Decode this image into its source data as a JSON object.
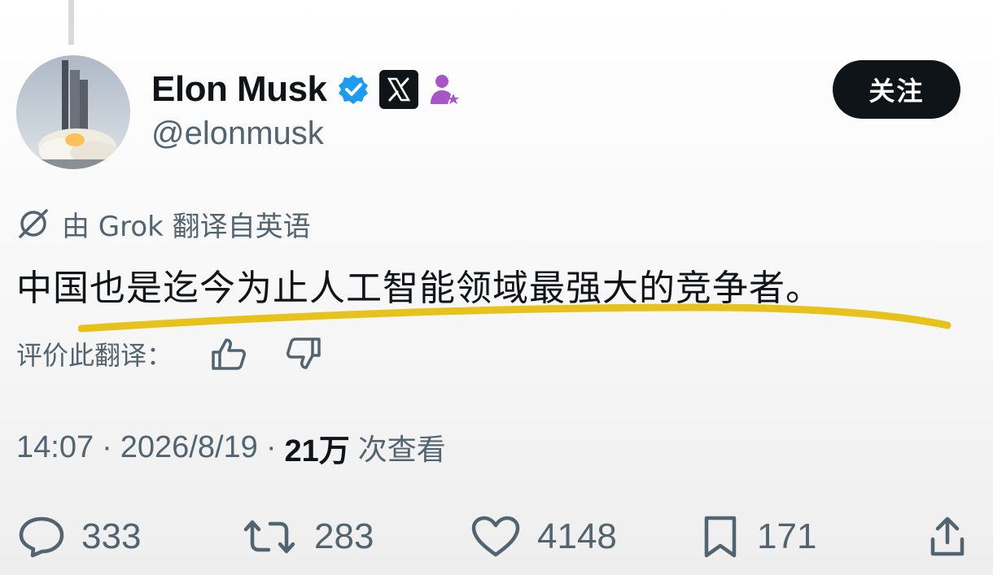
{
  "author": {
    "name": "Elon Musk",
    "handle": "@elonmusk",
    "verified": true,
    "affiliate_badge": "x-logo-icon"
  },
  "follow_button": {
    "label": "关注"
  },
  "translation": {
    "label": "由 Grok 翻译自英语",
    "text": "中国也是迄今为止人工智能领域最强大的竞争者。",
    "rate_label": "评价此翻译："
  },
  "meta": {
    "time": "14:07",
    "date": "2026/8/19",
    "views_count": "21万",
    "views_label": "次查看"
  },
  "actions": {
    "replies": "333",
    "reposts": "283",
    "likes": "4148",
    "bookmarks": "171"
  },
  "colors": {
    "text": "#0f1419",
    "secondary": "#536471",
    "verified": "#1d9bf0",
    "subscriber_badge": "#a855c7",
    "highlight": "#e6c21a"
  }
}
